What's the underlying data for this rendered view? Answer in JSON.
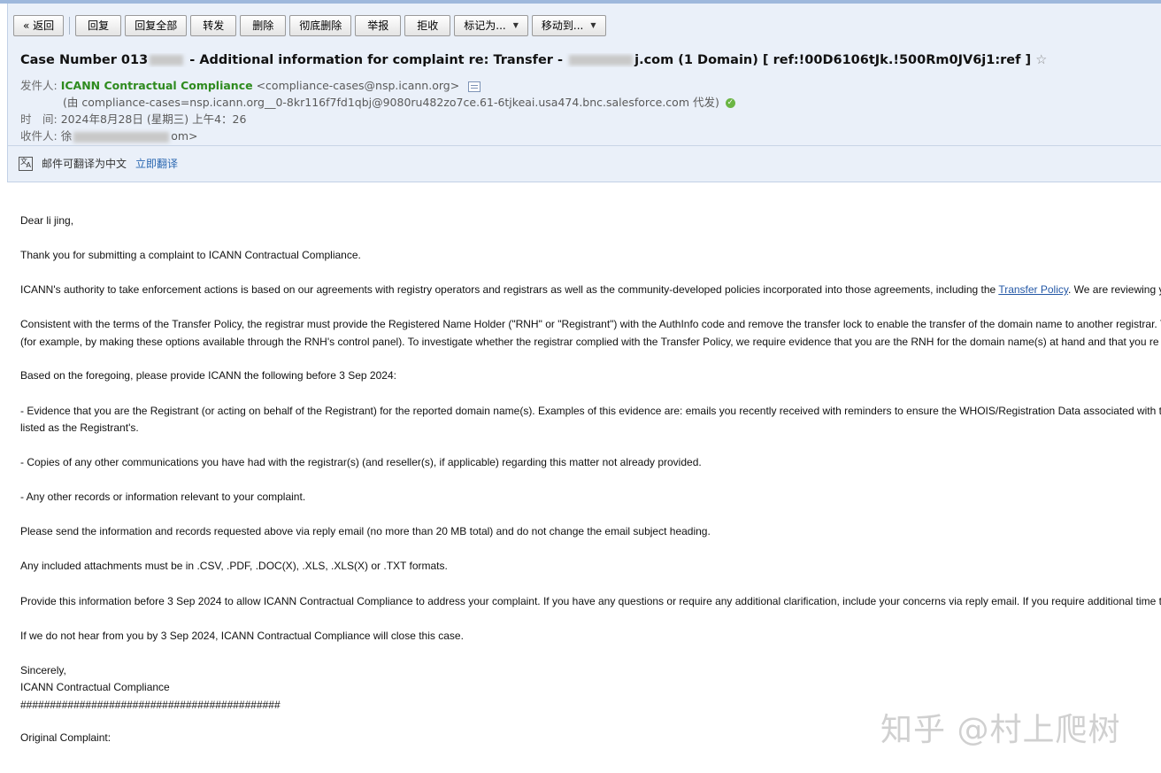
{
  "toolbar": {
    "back": "« 返回",
    "reply": "回复",
    "reply_all": "回复全部",
    "forward": "转发",
    "delete": "删除",
    "delete_permanently": "彻底删除",
    "report": "举报",
    "reject": "拒收",
    "mark_as": "标记为...",
    "move_to": "移动到..."
  },
  "email": {
    "subject_pre": "Case Number 013",
    "subject_mid": "- Additional information for complaint re: Transfer -",
    "subject_post": "j.com (1 Domain) [ ref:!00D6106tJk.!500Rm0JV6j1:ref ]",
    "star": "☆",
    "from_label": "发件人:",
    "from_name": "ICANN Contractual Compliance",
    "from_address": "<compliance-cases@nsp.icann.org>",
    "via": "(由 compliance-cases=nsp.icann.org__0-8kr116f7fd1qbj@9080ru482zo7ce.61-6tjkeai.usa474.bnc.salesforce.com 代发)",
    "time_label": "时　间:",
    "time_value": "2024年8月28日 (星期三) 上午4：26",
    "to_label": "收件人:",
    "to_pre": "徐",
    "to_post": "om>"
  },
  "translate": {
    "text": "邮件可翻译为中文",
    "action": "立即翻译"
  },
  "body": {
    "greeting": "Dear li jing,",
    "p1": "Thank you for submitting a complaint to ICANN Contractual Compliance.",
    "p2_before": "ICANN's authority to take enforcement actions is based on our agreements with registry operators and registrars as well as the community-developed policies incorporated into those agreements, including the ",
    "p2_link": "Transfer Policy",
    "p2_after": ". We are reviewing y",
    "p3_l1": "Consistent with the terms of the Transfer Policy, the registrar must provide the Registered Name Holder (\"RNH\" or \"Registrant\") with the AuthInfo code and remove the transfer lock to enable the transfer of the domain name to another registrar. T",
    "p3_l2": "(for example, by making these options available through the RNH's control panel). To investigate whether the registrar complied with the Transfer Policy, we require evidence that you are the RNH for the domain name(s) at hand and that you re",
    "p4": "Based on the foregoing, please provide ICANN the following before 3 Sep 2024:",
    "p5_l1": "- Evidence that you are the Registrant (or acting on behalf of the Registrant) for the reported domain name(s). Examples of this evidence are: emails you recently received with reminders to ensure the WHOIS/Registration Data associated with t",
    "p5_l2": "listed as the Registrant's.",
    "p6": "- Copies of any other communications you have had with the registrar(s) (and reseller(s), if applicable) regarding this matter not already provided.",
    "p7": "- Any other records or information relevant to your complaint.",
    "p8": "Please send the information and records requested above via reply email (no more than 20 MB total) and do not change the email subject heading.",
    "p9": "Any included attachments must be in .CSV, .PDF, .DOC(X), .XLS, .XLS(X) or .TXT formats.",
    "p10": "Provide this information before 3 Sep 2024 to allow ICANN Contractual Compliance to address your complaint. If you have any questions or require any additional clarification, include your concerns via reply email. If you require additional time t",
    "p11": "If we do not hear from you by 3 Sep 2024, ICANN Contractual Compliance will close this case.",
    "closing": "Sincerely,",
    "signature": "ICANN Contractual Compliance",
    "hashes": "############################################",
    "original": "Original Complaint:"
  },
  "watermark": "知乎 @村上爬树"
}
